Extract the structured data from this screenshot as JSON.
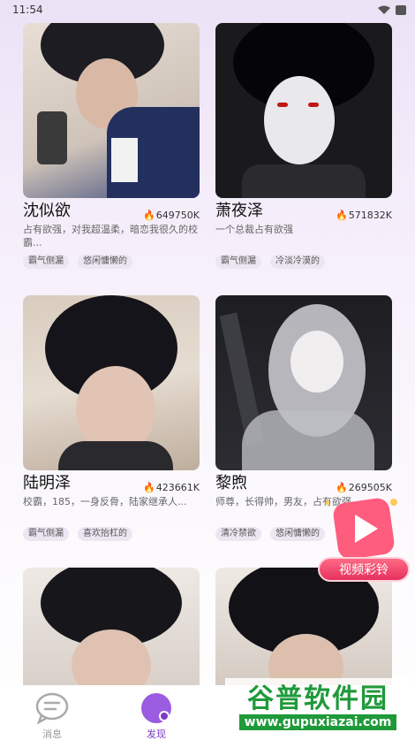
{
  "status": {
    "time": "11:54"
  },
  "cards": [
    {
      "name": "沈似欲",
      "hot": "649750K",
      "desc": "占有欲强，对我超温柔，暗恋我很久的校霸...",
      "tags": [
        "霸气侧漏",
        "悠闲慵懒的"
      ]
    },
    {
      "name": "萧夜泽",
      "hot": "571832K",
      "desc": "一个总裁占有欲强",
      "tags": [
        "霸气侧漏",
        "冷淡冷漠的"
      ]
    },
    {
      "name": "陆明泽",
      "hot": "423661K",
      "desc": "校霸，185，一身反骨，陆家继承人...",
      "tags": [
        "霸气侧漏",
        "喜欢抬杠的"
      ]
    },
    {
      "name": "黎煦",
      "hot": "269505K",
      "desc": "师尊，长得帅，男友，占有欲强",
      "tags": [
        "清冷禁欲",
        "悠闲慵懒的"
      ]
    }
  ],
  "promo": {
    "label": "视频彩铃"
  },
  "nav": {
    "messages": "消息",
    "discover": "发现"
  },
  "watermark": {
    "title": "谷普软件园",
    "url": "www.gupuxiazai.com"
  },
  "colors": {
    "accent": "#7a3cc4",
    "flame": "#f06a1e",
    "tag_bg": "#ece6f2"
  }
}
